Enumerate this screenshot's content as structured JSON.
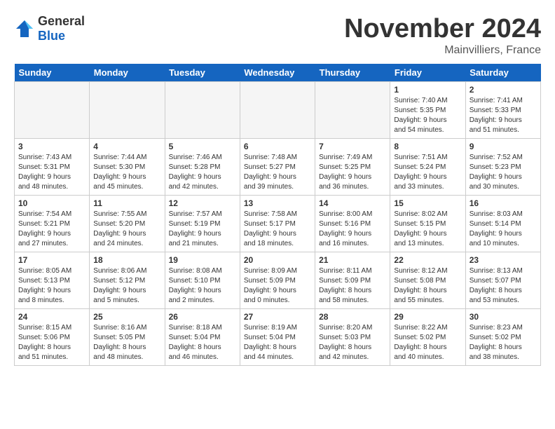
{
  "header": {
    "logo_line1": "General",
    "logo_line2": "Blue",
    "month_title": "November 2024",
    "location": "Mainvilliers, France"
  },
  "columns": [
    "Sunday",
    "Monday",
    "Tuesday",
    "Wednesday",
    "Thursday",
    "Friday",
    "Saturday"
  ],
  "weeks": [
    [
      {
        "day": "",
        "info": ""
      },
      {
        "day": "",
        "info": ""
      },
      {
        "day": "",
        "info": ""
      },
      {
        "day": "",
        "info": ""
      },
      {
        "day": "",
        "info": ""
      },
      {
        "day": "1",
        "info": "Sunrise: 7:40 AM\nSunset: 5:35 PM\nDaylight: 9 hours\nand 54 minutes."
      },
      {
        "day": "2",
        "info": "Sunrise: 7:41 AM\nSunset: 5:33 PM\nDaylight: 9 hours\nand 51 minutes."
      }
    ],
    [
      {
        "day": "3",
        "info": "Sunrise: 7:43 AM\nSunset: 5:31 PM\nDaylight: 9 hours\nand 48 minutes."
      },
      {
        "day": "4",
        "info": "Sunrise: 7:44 AM\nSunset: 5:30 PM\nDaylight: 9 hours\nand 45 minutes."
      },
      {
        "day": "5",
        "info": "Sunrise: 7:46 AM\nSunset: 5:28 PM\nDaylight: 9 hours\nand 42 minutes."
      },
      {
        "day": "6",
        "info": "Sunrise: 7:48 AM\nSunset: 5:27 PM\nDaylight: 9 hours\nand 39 minutes."
      },
      {
        "day": "7",
        "info": "Sunrise: 7:49 AM\nSunset: 5:25 PM\nDaylight: 9 hours\nand 36 minutes."
      },
      {
        "day": "8",
        "info": "Sunrise: 7:51 AM\nSunset: 5:24 PM\nDaylight: 9 hours\nand 33 minutes."
      },
      {
        "day": "9",
        "info": "Sunrise: 7:52 AM\nSunset: 5:23 PM\nDaylight: 9 hours\nand 30 minutes."
      }
    ],
    [
      {
        "day": "10",
        "info": "Sunrise: 7:54 AM\nSunset: 5:21 PM\nDaylight: 9 hours\nand 27 minutes."
      },
      {
        "day": "11",
        "info": "Sunrise: 7:55 AM\nSunset: 5:20 PM\nDaylight: 9 hours\nand 24 minutes."
      },
      {
        "day": "12",
        "info": "Sunrise: 7:57 AM\nSunset: 5:19 PM\nDaylight: 9 hours\nand 21 minutes."
      },
      {
        "day": "13",
        "info": "Sunrise: 7:58 AM\nSunset: 5:17 PM\nDaylight: 9 hours\nand 18 minutes."
      },
      {
        "day": "14",
        "info": "Sunrise: 8:00 AM\nSunset: 5:16 PM\nDaylight: 9 hours\nand 16 minutes."
      },
      {
        "day": "15",
        "info": "Sunrise: 8:02 AM\nSunset: 5:15 PM\nDaylight: 9 hours\nand 13 minutes."
      },
      {
        "day": "16",
        "info": "Sunrise: 8:03 AM\nSunset: 5:14 PM\nDaylight: 9 hours\nand 10 minutes."
      }
    ],
    [
      {
        "day": "17",
        "info": "Sunrise: 8:05 AM\nSunset: 5:13 PM\nDaylight: 9 hours\nand 8 minutes."
      },
      {
        "day": "18",
        "info": "Sunrise: 8:06 AM\nSunset: 5:12 PM\nDaylight: 9 hours\nand 5 minutes."
      },
      {
        "day": "19",
        "info": "Sunrise: 8:08 AM\nSunset: 5:10 PM\nDaylight: 9 hours\nand 2 minutes."
      },
      {
        "day": "20",
        "info": "Sunrise: 8:09 AM\nSunset: 5:09 PM\nDaylight: 9 hours\nand 0 minutes."
      },
      {
        "day": "21",
        "info": "Sunrise: 8:11 AM\nSunset: 5:09 PM\nDaylight: 8 hours\nand 58 minutes."
      },
      {
        "day": "22",
        "info": "Sunrise: 8:12 AM\nSunset: 5:08 PM\nDaylight: 8 hours\nand 55 minutes."
      },
      {
        "day": "23",
        "info": "Sunrise: 8:13 AM\nSunset: 5:07 PM\nDaylight: 8 hours\nand 53 minutes."
      }
    ],
    [
      {
        "day": "24",
        "info": "Sunrise: 8:15 AM\nSunset: 5:06 PM\nDaylight: 8 hours\nand 51 minutes."
      },
      {
        "day": "25",
        "info": "Sunrise: 8:16 AM\nSunset: 5:05 PM\nDaylight: 8 hours\nand 48 minutes."
      },
      {
        "day": "26",
        "info": "Sunrise: 8:18 AM\nSunset: 5:04 PM\nDaylight: 8 hours\nand 46 minutes."
      },
      {
        "day": "27",
        "info": "Sunrise: 8:19 AM\nSunset: 5:04 PM\nDaylight: 8 hours\nand 44 minutes."
      },
      {
        "day": "28",
        "info": "Sunrise: 8:20 AM\nSunset: 5:03 PM\nDaylight: 8 hours\nand 42 minutes."
      },
      {
        "day": "29",
        "info": "Sunrise: 8:22 AM\nSunset: 5:02 PM\nDaylight: 8 hours\nand 40 minutes."
      },
      {
        "day": "30",
        "info": "Sunrise: 8:23 AM\nSunset: 5:02 PM\nDaylight: 8 hours\nand 38 minutes."
      }
    ]
  ]
}
